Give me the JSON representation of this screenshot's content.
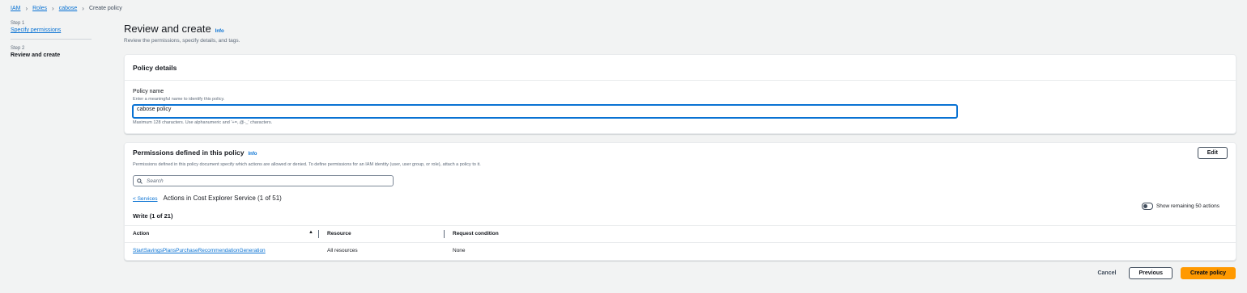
{
  "breadcrumb": {
    "items": [
      "IAM",
      "Roles",
      "cabose"
    ],
    "current": "Create policy"
  },
  "steps": [
    {
      "label": "Step 1",
      "title": "Specify permissions"
    },
    {
      "label": "Step 2",
      "title": "Review and create"
    }
  ],
  "page": {
    "title": "Review and create",
    "info": "Info",
    "description": "Review the permissions, specify details, and tags."
  },
  "policy_details": {
    "heading": "Policy details",
    "name_label": "Policy name",
    "name_desc": "Enter a meaningful name to identify this policy.",
    "name_value": "cabose policy",
    "name_constraint": "Maximum 128 characters. Use alphanumeric and '+=,.@-_' characters."
  },
  "permissions": {
    "heading": "Permissions defined in this policy",
    "info": "Info",
    "description": "Permissions defined in this policy document specify which actions are allowed or denied. To define permissions for an IAM identity (user, user group, or role), attach a policy to it.",
    "edit_label": "Edit",
    "search_placeholder": "Search",
    "services_link": "< Services",
    "actions_title": "Actions in Cost Explorer Service (1 of 51)",
    "toggle_label": "Show remaining 50 actions",
    "write_label": "Write (1 of 21)",
    "columns": [
      "Action",
      "Resource",
      "Request condition"
    ],
    "rows": [
      {
        "action": "StartSavingsPlansPurchaseRecommendationGeneration",
        "resource": "All resources",
        "condition": "None"
      }
    ]
  },
  "footer": {
    "cancel": "Cancel",
    "previous": "Previous",
    "create": "Create policy"
  },
  "colors": {
    "link": "#0972d3",
    "primary_button": "#ff9900",
    "background": "#f2f3f3"
  },
  "icons": [
    "chevron-right-icon",
    "search-icon",
    "sort-up-icon",
    "toggle-switch-icon"
  ]
}
